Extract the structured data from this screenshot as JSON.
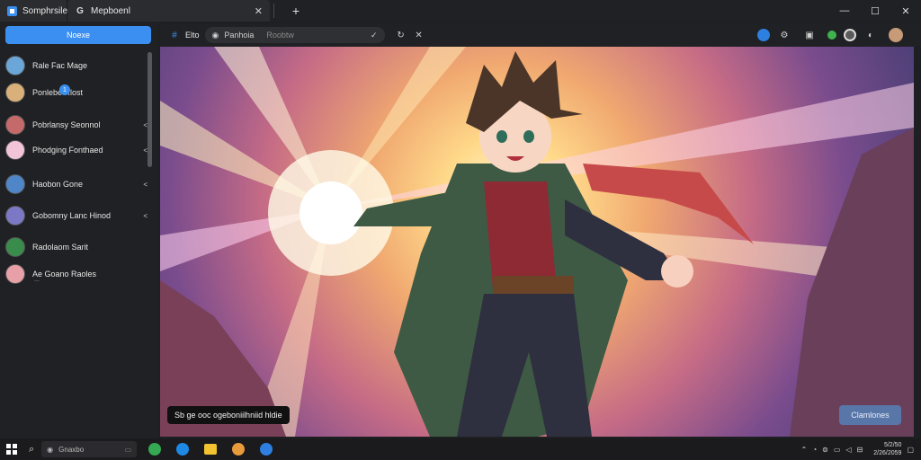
{
  "window": {
    "tabs": [
      {
        "label": "Somphrsiler",
        "icon": "app-square-icon"
      },
      {
        "label": "Mepboenl",
        "icon": "g-logo-icon"
      }
    ],
    "close_glyph": "✕",
    "new_tab_glyph": "+"
  },
  "toolbar": {
    "left_label": "Elto",
    "omnibox_label": "Panhoia",
    "omnibox_placeholder": "Roobtw"
  },
  "sidebar": {
    "new_button_label": "Noexe",
    "badge": "1",
    "items": [
      {
        "label": "Rale Fac Mage",
        "avatar_color": "#6aa6d8"
      },
      {
        "label": "Ponlebe Rlost",
        "avatar_color": "#d9b07a"
      },
      {
        "label": "Pobrlansy Seonnol",
        "avatar_color": "#c46a6a",
        "chevron": "<"
      },
      {
        "label": "Phodging Fonthaed",
        "avatar_color": "#f1c4d8",
        "chevron": "<"
      },
      {
        "label": "Haobon Gone",
        "avatar_color": "#4f86c8",
        "chevron": "<"
      },
      {
        "label": "Gobomny Lanc Hinod",
        "avatar_color": "#7c78c6",
        "chevron": "<"
      },
      {
        "label": "Radolaom Sarit",
        "avatar_color": "#3a8c4c"
      },
      {
        "label": "Ae Goano Raoles",
        "avatar_color": "#e8a0a8"
      }
    ],
    "last_sub": "..."
  },
  "viewer": {
    "caption": "Sb ge ooc ogeboniilhniid hldie",
    "action_button": "Clamlones"
  },
  "taskbar": {
    "search_label": "Gnaxbo",
    "clock_time": "5/2/50",
    "clock_date": "2/26/2059"
  },
  "colors": {
    "accent": "#3b8ff0",
    "action": "#5876a8"
  }
}
